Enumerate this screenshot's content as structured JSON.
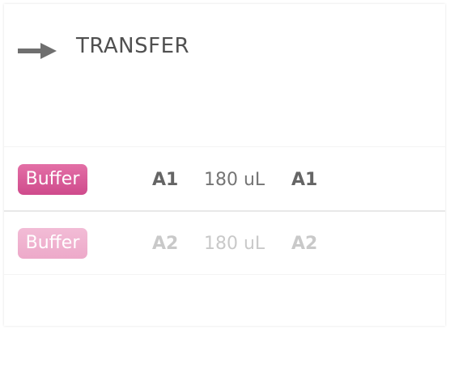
{
  "step": {
    "title": "TRANSFER",
    "icon": "arrow-right-icon"
  },
  "colors": {
    "badge_active": "#d6579a",
    "badge_inactive": "#f0b4d0",
    "text_dark": "#656565",
    "text_muted": "#c9c9c9"
  },
  "transfers": [
    {
      "reagent": "Buffer",
      "source_well": "A1",
      "volume": "180 uL",
      "dest_well": "A1"
    },
    {
      "reagent": "Buffer",
      "source_well": "A2",
      "volume": "180 uL",
      "dest_well": "A2"
    }
  ]
}
